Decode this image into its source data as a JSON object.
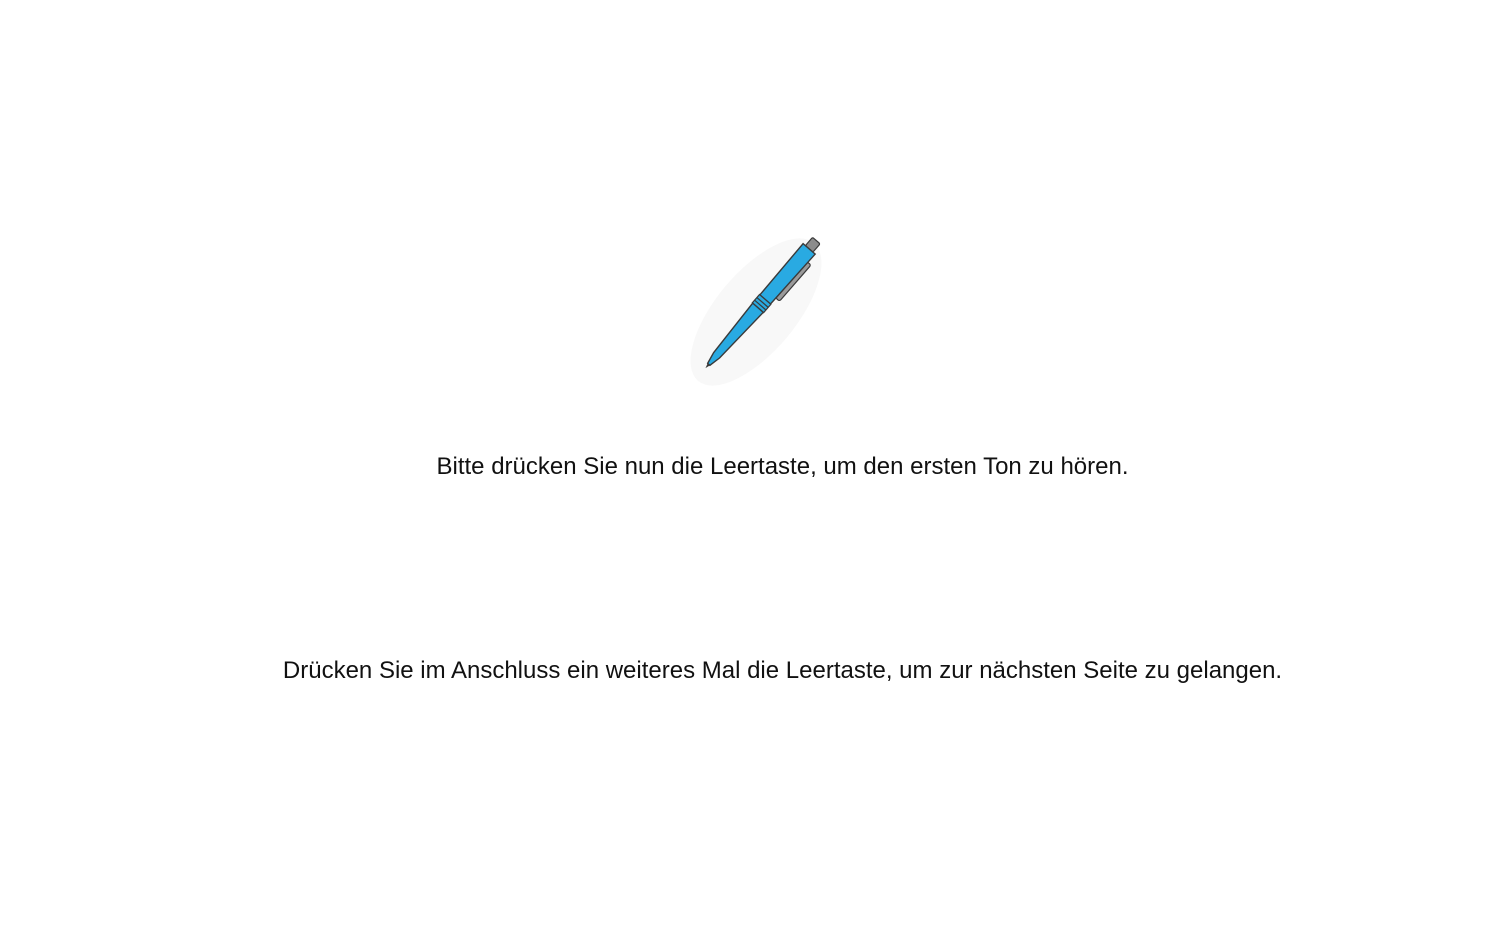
{
  "image": {
    "icon": "pen-icon",
    "body_color": "#29aae2",
    "outline_color": "#3a3a3a",
    "clip_color": "#9a9a9a"
  },
  "instructions": {
    "first": "Bitte drücken Sie nun die Leertaste, um den ersten Ton zu hören.",
    "second": "Drücken Sie im Anschluss ein weiteres Mal die Leertaste, um zur nächsten Seite zu gelangen."
  }
}
